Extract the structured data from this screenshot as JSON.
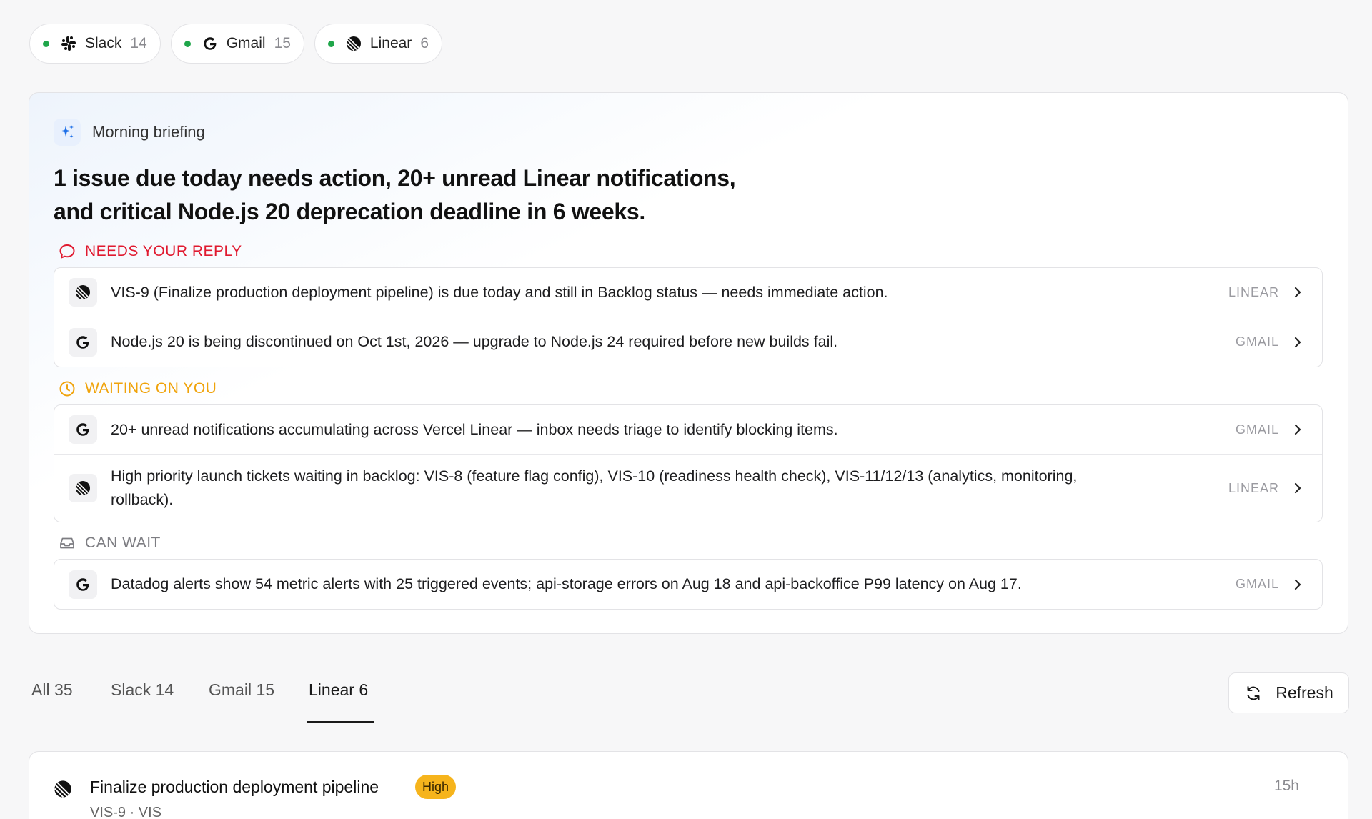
{
  "sources": [
    {
      "name": "Slack",
      "count": "14",
      "icon": "slack-icon"
    },
    {
      "name": "Gmail",
      "count": "15",
      "icon": "gmail-icon"
    },
    {
      "name": "Linear",
      "count": "6",
      "icon": "linear-icon"
    }
  ],
  "briefing": {
    "label": "Morning briefing",
    "headline_line1": "1 issue due today needs action, 20+ unread Linear notifications,",
    "headline_line2": "and critical Node.js 20 deprecation deadline in 6 weeks.",
    "sections": {
      "reply": {
        "label": "NEEDS YOUR REPLY",
        "items": [
          {
            "text": "VIS-9 (Finalize production deployment pipeline) is due today and still in Backlog status — needs immediate action.",
            "source": "LINEAR"
          },
          {
            "text": "Node.js 20 is being discontinued on Oct 1st, 2026 — upgrade to Node.js 24 required before new builds fail.",
            "source": "GMAIL"
          }
        ]
      },
      "waiting": {
        "label": "WAITING ON YOU",
        "items": [
          {
            "text": "20+ unread notifications accumulating across Vercel Linear — inbox needs triage to identify blocking items.",
            "source": "GMAIL"
          },
          {
            "text": "High priority launch tickets waiting in backlog: VIS-8 (feature flag config), VIS-10 (readiness health check), VIS-11/12/13 (analytics, monitoring, rollback).",
            "source": "LINEAR"
          }
        ]
      },
      "later": {
        "label": "CAN WAIT",
        "items": [
          {
            "text": "Datadog alerts show 54 metric alerts with 25 triggered events; api-storage errors on Aug 18 and api-backoffice P99 latency on Aug 17.",
            "source": "GMAIL"
          }
        ]
      }
    }
  },
  "tabs": [
    {
      "label": "All 35"
    },
    {
      "label": "Slack 14"
    },
    {
      "label": "Gmail 15"
    },
    {
      "label": "Linear 6",
      "active": true
    }
  ],
  "refresh_label": "Refresh",
  "issue": {
    "title": "Finalize production deployment pipeline",
    "priority": "High",
    "time": "15h",
    "meta": "VIS-9 · VIS"
  },
  "colors": {
    "status_dot": "#1fa64a",
    "reply": "#e0192f",
    "waiting": "#f0a30a",
    "later": "#7d7d82",
    "priority_high": "#f6b41c",
    "spark": "#1d6fe8"
  }
}
